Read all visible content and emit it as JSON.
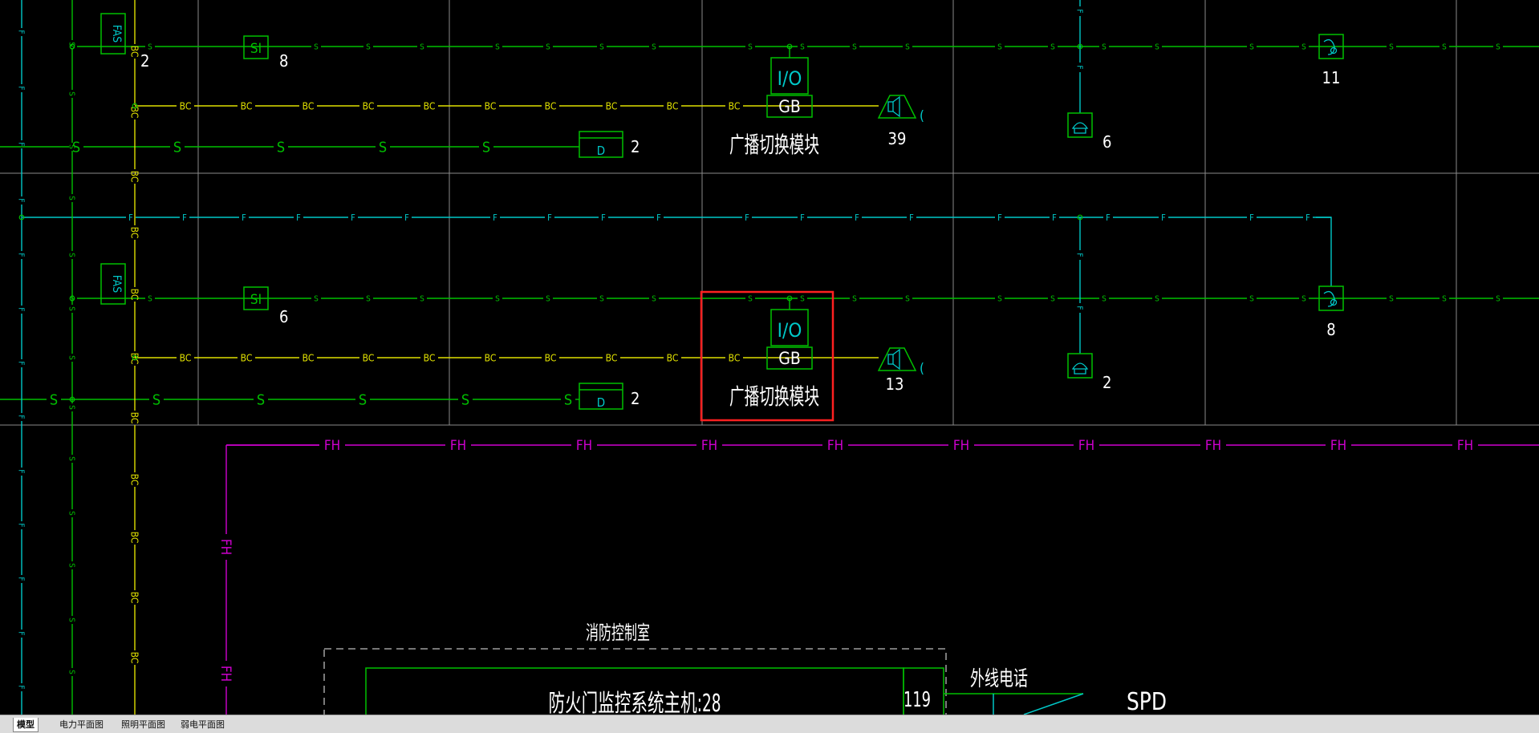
{
  "tabs": [
    {
      "label": "模型",
      "active": true
    },
    {
      "label": "电力平面图",
      "active": false
    },
    {
      "label": "照明平面图",
      "active": false
    },
    {
      "label": "弱电平面图",
      "active": false
    }
  ],
  "wire_labels": {
    "signal": "S",
    "broadcast": "BC",
    "fire": "F",
    "fire_door": "FH"
  },
  "colors": {
    "background": "#000000",
    "signal": "#00c000",
    "broadcast": "#e0e000",
    "fire": "#00c8c8",
    "fire_door": "#d000d0",
    "grid": "#8a8a8a",
    "text": "#ffffff",
    "highlight": "#ff2020"
  },
  "symbols": {
    "fas": "FAS",
    "si": "SI",
    "io": "I/O",
    "gb": "GB",
    "d": "D",
    "bracket": "("
  },
  "rows": [
    {
      "fas_label": "2",
      "si_count": "8",
      "d_count": "2",
      "speaker_count": "39",
      "module_label": "广播切换模块",
      "phone_count": "6",
      "cyan_device_count": "11"
    },
    {
      "fas_label": "",
      "si_count": "6",
      "d_count": "2",
      "speaker_count": "13",
      "module_label": "广播切换模块",
      "phone_count": "2",
      "cyan_device_count": "8"
    }
  ],
  "control_room": {
    "title": "消防控制室",
    "host_label": "防火门监控系统主机:28",
    "emergency_no": "119",
    "external_phone": "外线电话",
    "spd": "SPD"
  }
}
